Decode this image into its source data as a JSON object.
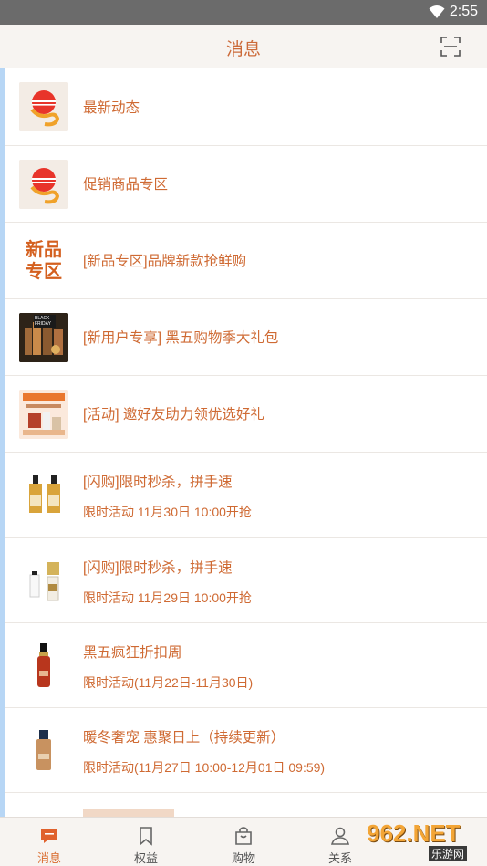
{
  "status_bar": {
    "time": "2:55",
    "wifi_icon": "wifi-icon"
  },
  "header": {
    "title": "消息",
    "scan_icon": "scan-icon"
  },
  "messages": [
    {
      "title": "最新动态",
      "thumb": "brand-logo"
    },
    {
      "title": "促销商品专区",
      "thumb": "brand-logo"
    },
    {
      "title": "[新品专区]品牌新款抢鲜购",
      "thumb_text": "新品\n专区"
    },
    {
      "title": "[新用户专享] 黑五购物季大礼包",
      "thumb": "black-friday-banner",
      "thumb_text": "BLACK FRIDAY"
    },
    {
      "title": "[活动] 邀好友助力领优选好礼",
      "thumb": "gift-promo-banner"
    },
    {
      "title": "[闪购]限时秒杀，拼手速",
      "subtitle": "限时活动 11月30日 10:00开抢",
      "thumb": "serum-bottles"
    },
    {
      "title": "[闪购]限时秒杀，拼手速",
      "subtitle": "限时活动 11月29日 10:00开抢",
      "thumb": "perfume-bottle"
    },
    {
      "title": "黑五疯狂折扣周",
      "subtitle": "限时活动(11月22日-11月30日)",
      "thumb": "red-serum-bottle"
    },
    {
      "title": "暖冬奢宠 惠聚日上（持续更新）",
      "subtitle": "限时活动(11月27日 10:00-12月01日 09:59)",
      "thumb": "foundation-bottle"
    }
  ],
  "bottom_nav": [
    {
      "label": "消息",
      "icon": "chat-icon",
      "active": true
    },
    {
      "label": "权益",
      "icon": "bookmark-icon",
      "active": false
    },
    {
      "label": "购物",
      "icon": "shopping-bag-icon",
      "active": false
    },
    {
      "label": "关系",
      "icon": "contact-icon",
      "active": false
    }
  ],
  "watermark": {
    "main": "962.NET",
    "sub": "乐游网"
  },
  "colors": {
    "accent": "#cf6a33",
    "header_bg": "#f7f4f1",
    "status_bar": "#6b6b6b",
    "side_bar": "#b7d6f5"
  }
}
